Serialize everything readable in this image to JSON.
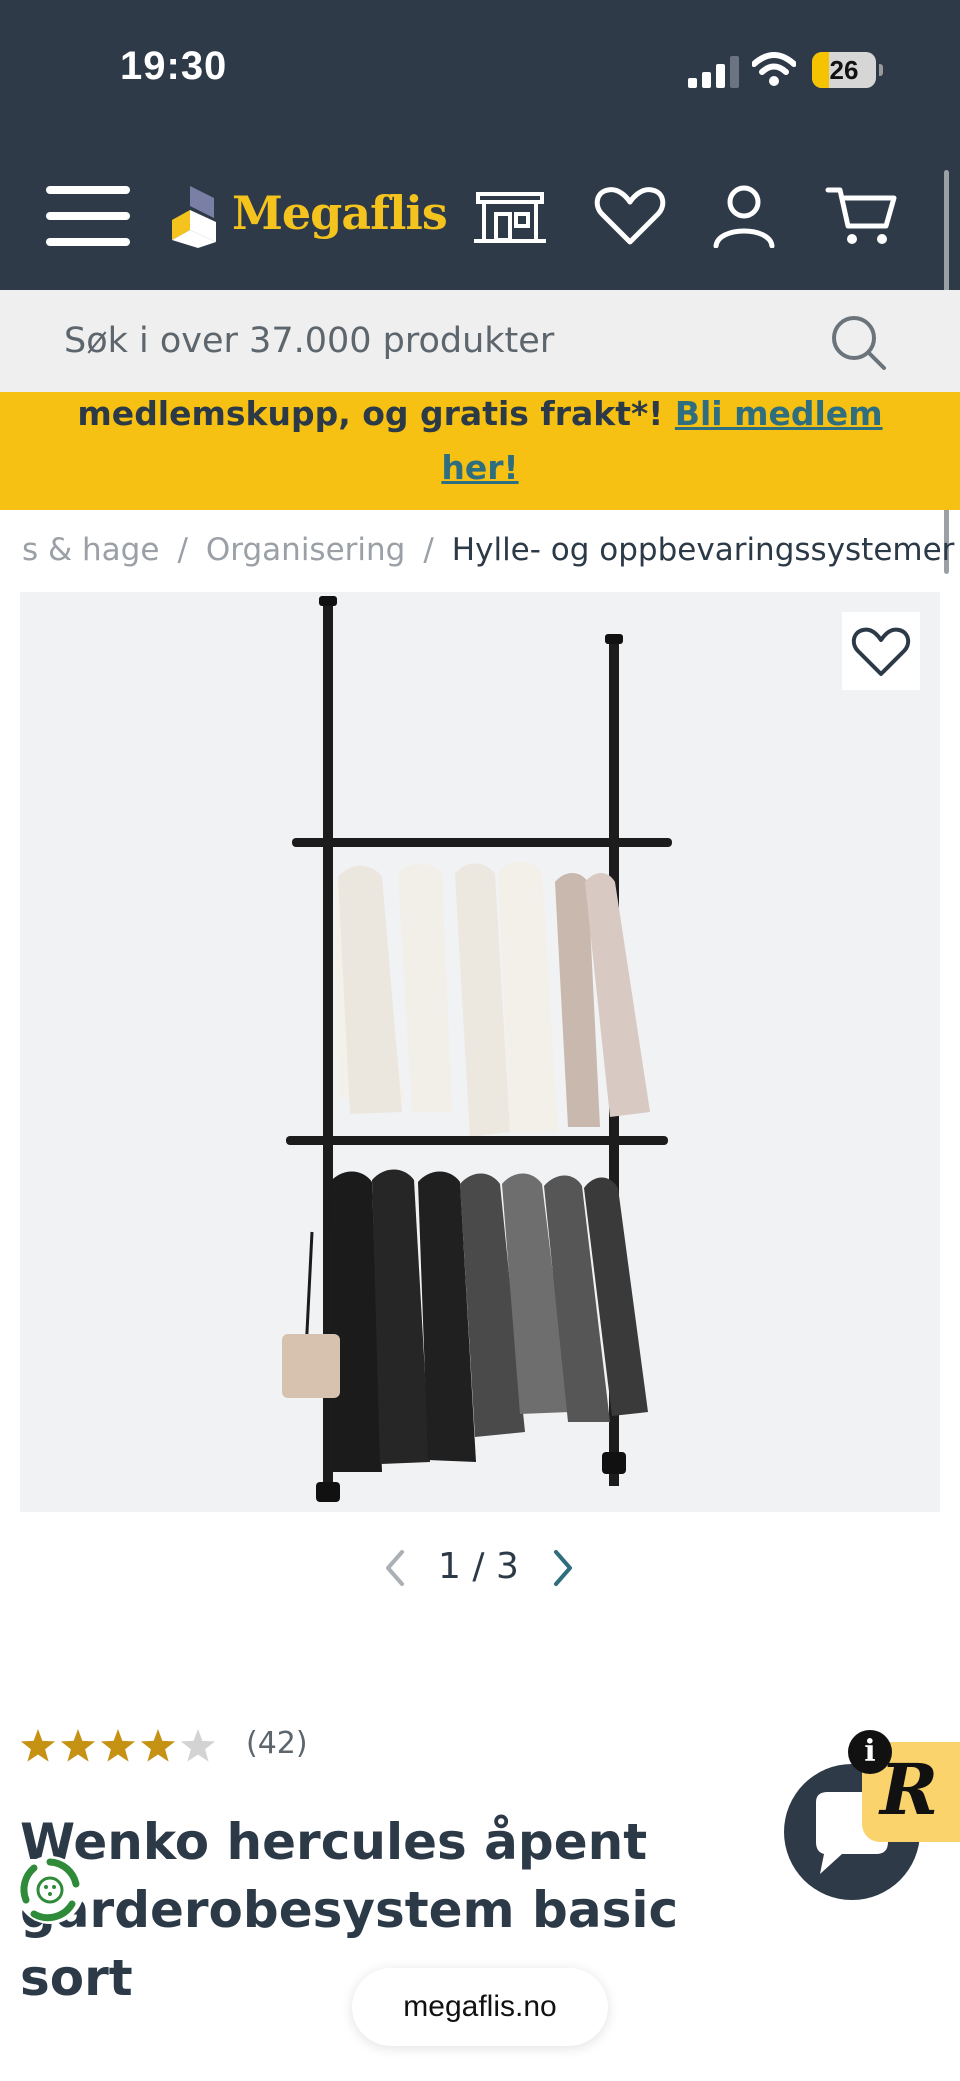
{
  "status_bar": {
    "time": "19:30",
    "battery": "26",
    "battery_level": 0.26
  },
  "header": {
    "brand": "Megaflis",
    "icons": [
      "menu-icon",
      "store-icon",
      "heart-icon",
      "user-icon",
      "cart-icon"
    ]
  },
  "search": {
    "placeholder": "Søk i over 37.000 produkter"
  },
  "banner": {
    "text": "medlemskupp, og gratis frakt*!",
    "link_part1": "Bli medlem",
    "link_part2": "her!"
  },
  "breadcrumb": [
    "s & hage",
    "Organisering",
    "Hylle- og oppbevaringssystemer"
  ],
  "gallery": {
    "current": "1",
    "separator": "/",
    "total": "3"
  },
  "product": {
    "rating": 4,
    "rating_max": 5,
    "review_count": "(42)",
    "title": "Wenko hercules åpent garderobesystem basic sort",
    "title_line1": "Wenko hercules åpent",
    "title_line2": "garderobesystem basic sort"
  },
  "browser": {
    "url": "megaflis.no"
  },
  "colors": {
    "header_bg": "#2e3a48",
    "brand_yellow": "#f5c31d",
    "banner_bg": "#f7c113",
    "link_teal": "#2f6e7e",
    "star_gold": "#c69214"
  }
}
